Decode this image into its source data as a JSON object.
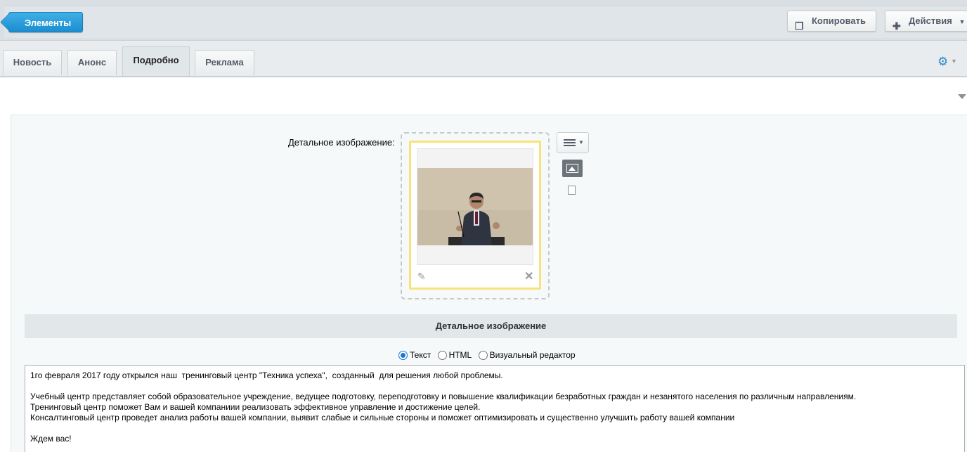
{
  "toolbar": {
    "elements_label": "Элементы",
    "copy_label": "Копировать",
    "actions_label": "Действия"
  },
  "tabs": [
    {
      "label": "Новость"
    },
    {
      "label": "Анонс"
    },
    {
      "label": "Подробно"
    },
    {
      "label": "Реклама"
    }
  ],
  "detail_image": {
    "field_label": "Детальное изображение:"
  },
  "section": {
    "title": "Детальное изображение"
  },
  "editor_mode": {
    "options": [
      "Текст",
      "HTML",
      "Визуальный редактор"
    ],
    "selected": "Текст"
  },
  "detail_text": "1го февраля 2017 году открылся наш  тренинговый центр \"Техника успеха\",  созданный  для решения любой проблемы.\n\nУчебный центр представляет собой образовательное учреждение, ведущее подготовку, переподготовку и повышение квалификации безработных граждан и незанятого населения по различным направлениям.\nТренинговый центр поможет Вам и вашей компаниии реализовать эффективное управление и достижение целей.\nКонсалтинговый центр проведет анализ работы вашей компании, выявит слабые и сильные стороны и поможет оптимизировать и существенно улучшить работу вашей компании\n\nЖдем вас!",
  "colors": {
    "accent": "#1c8dcf",
    "highlight_frame": "#f8e37a"
  }
}
